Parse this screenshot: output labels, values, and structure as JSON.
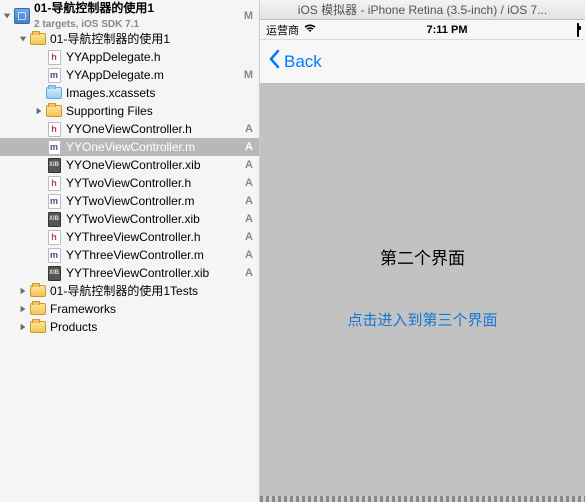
{
  "project": {
    "name": "01-导航控制器的使用1",
    "subtitle": "2 targets, iOS SDK 7.1",
    "status": "M"
  },
  "groups": {
    "main": "01-导航控制器的使用1",
    "tests": "01-导航控制器的使用1Tests",
    "frameworks": "Frameworks",
    "products": "Products"
  },
  "files": {
    "appDelegateH": "YYAppDelegate.h",
    "appDelegateM": "YYAppDelegate.m",
    "imagesAssets": "Images.xcassets",
    "supportingFiles": "Supporting Files",
    "oneH": "YYOneViewController.h",
    "oneM": "YYOneViewController.m",
    "oneXib": "YYOneViewController.xib",
    "twoH": "YYTwoViewController.h",
    "twoM": "YYTwoViewController.m",
    "twoXib": "YYTwoViewController.xib",
    "threeH": "YYThreeViewController.h",
    "threeM": "YYThreeViewController.m",
    "threeXib": "YYThreeViewController.xib"
  },
  "statusA": "A",
  "statusM": "M",
  "simulator": {
    "windowTitle": "iOS 模拟器 - iPhone Retina (3.5-inch) / iOS 7...",
    "carrier": "运营商",
    "time": "7:11 PM",
    "backLabel": "Back",
    "screenTitle": "第二个界面",
    "screenLink": "点击进入到第三个界面"
  }
}
